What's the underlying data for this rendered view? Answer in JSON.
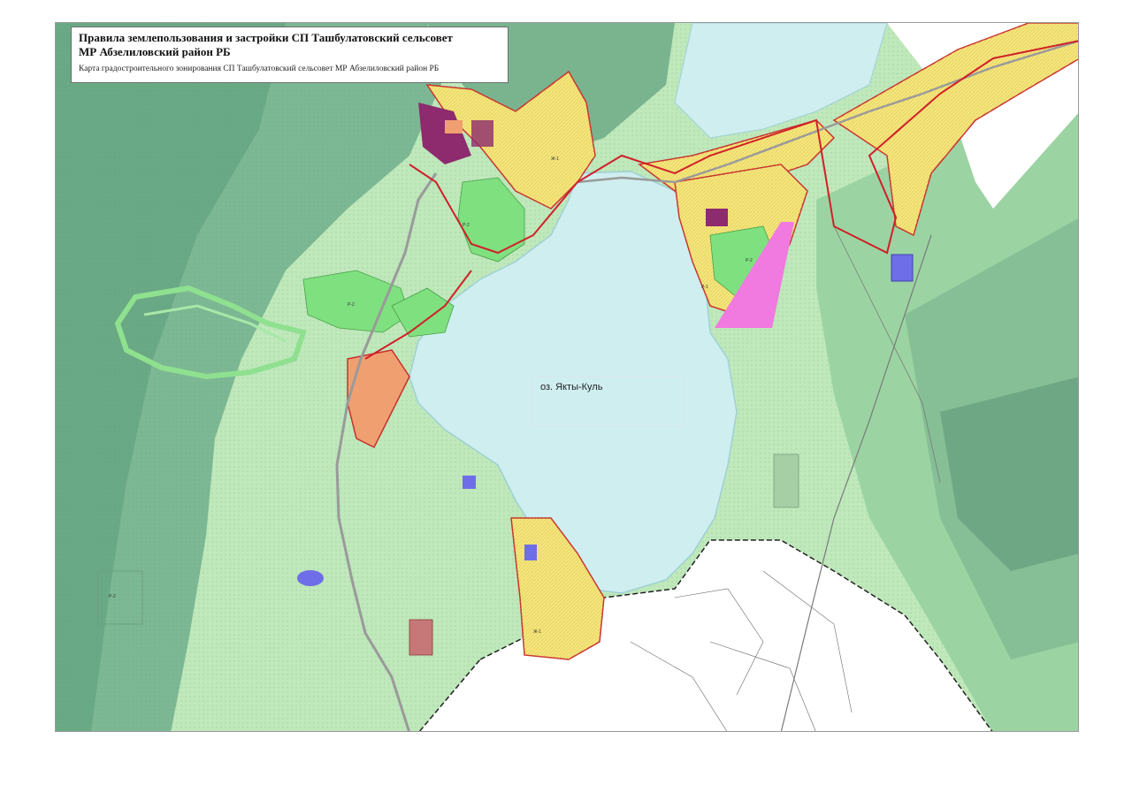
{
  "map": {
    "title_line1": "Правила землепользования и застройки СП Ташбулатовский сельсовет",
    "title_line2": "МР Абзелиловский район РБ",
    "subtitle": "Карта градостроительного зонирования СП Ташбулатовский сельсовет МР Абзелиловский район РБ",
    "lake_label": "оз. Якты-Куль"
  },
  "colors": {
    "forest_dark": "#6fb08a",
    "forest_mid": "#86c39a",
    "meadow_light": "#b5e6b5",
    "water": "#cfeef0",
    "residential": "#f5e77a",
    "recreation": "#7fe07f",
    "industrial": "#8e2a6e",
    "public": "#f0a070",
    "special": "#f07ae0",
    "boundary": "#d0202a"
  },
  "zone_codes": [
    "Р-2",
    "Р-1",
    "Ж-1",
    "Ж-2"
  ]
}
